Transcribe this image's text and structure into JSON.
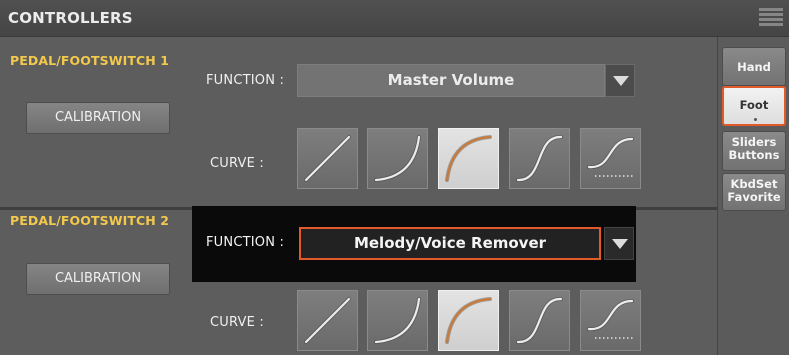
{
  "header": {
    "title": "CONTROLLERS",
    "menu_icon": "hamburger-menu-icon"
  },
  "sections": [
    {
      "title": "PEDAL/FOOTSWITCH 1",
      "calibration_label": "CALIBRATION",
      "function_label": "FUNCTION :",
      "function_value": "Master Volume",
      "curve_label": "CURVE :",
      "curves": [
        "linear-curve-icon",
        "exponential-curve-icon",
        "logarithmic-curve-icon",
        "s-curve-icon",
        "s-curve-dotted-icon"
      ],
      "selected_curve": 3
    },
    {
      "title": "PEDAL/FOOTSWITCH 2",
      "calibration_label": "CALIBRATION",
      "function_label": "FUNCTION :",
      "function_value": "Melody/Voice Remover",
      "curve_label": "CURVE :",
      "curves": [
        "linear-curve-icon",
        "exponential-curve-icon",
        "logarithmic-curve-icon",
        "s-curve-icon",
        "s-curve-dotted-icon"
      ],
      "selected_curve": 3
    }
  ],
  "sidebar": {
    "tabs": [
      {
        "label_lines": [
          "Hand"
        ]
      },
      {
        "label_lines": [
          "Foot"
        ],
        "active": true
      },
      {
        "label_lines": [
          "Sliders",
          "Buttons"
        ]
      },
      {
        "label_lines": [
          "KbdSet",
          "Favorite"
        ]
      }
    ]
  },
  "colors": {
    "accent": "#e35a2a",
    "section_title": "#f2c94c",
    "background": "#5d5d5d",
    "curve_line": "#c87a3a"
  }
}
